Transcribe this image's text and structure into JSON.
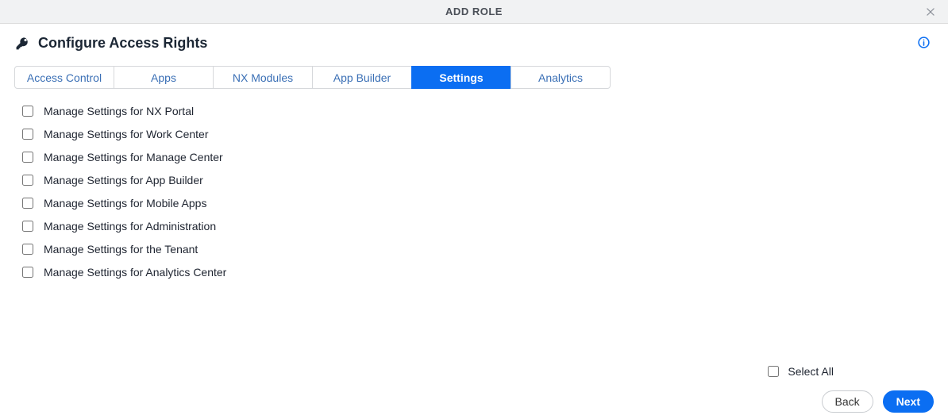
{
  "modal": {
    "title": "ADD ROLE"
  },
  "header": {
    "title": "Configure Access Rights"
  },
  "tabs": [
    {
      "label": "Access Control",
      "active": false
    },
    {
      "label": "Apps",
      "active": false
    },
    {
      "label": "NX Modules",
      "active": false
    },
    {
      "label": "App Builder",
      "active": false
    },
    {
      "label": "Settings",
      "active": true
    },
    {
      "label": "Analytics",
      "active": false
    }
  ],
  "permissions": [
    {
      "label": "Manage Settings for NX Portal",
      "checked": false
    },
    {
      "label": "Manage Settings for Work Center",
      "checked": false
    },
    {
      "label": "Manage Settings for Manage Center",
      "checked": false
    },
    {
      "label": "Manage Settings for App Builder",
      "checked": false
    },
    {
      "label": "Manage Settings for Mobile Apps",
      "checked": false
    },
    {
      "label": "Manage Settings for Administration",
      "checked": false
    },
    {
      "label": "Manage Settings for the Tenant",
      "checked": false
    },
    {
      "label": "Manage Settings for Analytics Center",
      "checked": false
    }
  ],
  "footer": {
    "select_all_label": "Select All",
    "back_label": "Back",
    "next_label": "Next"
  }
}
